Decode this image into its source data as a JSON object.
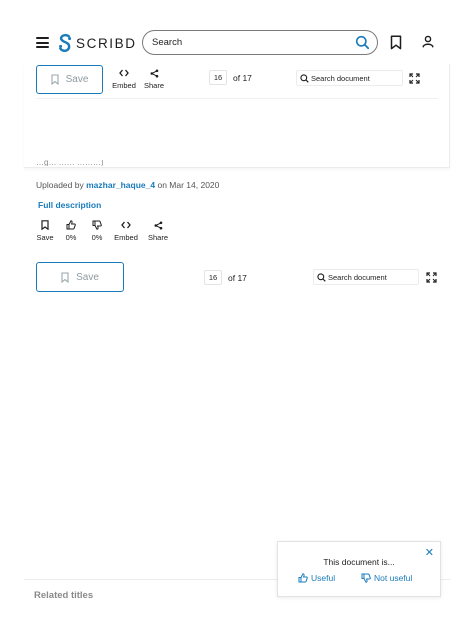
{
  "header": {
    "logo_text": "SCRIBD",
    "search_placeholder": "Search",
    "brand_color": "#1a7bba"
  },
  "toolbar": {
    "save_label": "Save",
    "embed_label": "Embed",
    "share_label": "Share",
    "current_page": "16",
    "page_of": "of 17",
    "search_doc_placeholder": "Search document"
  },
  "document": {
    "uploaded_prefix": "Uploaded by",
    "uploader": "mazhar_haque_4",
    "uploaded_on": "on Mar 14, 2020",
    "full_description_label": "Full description",
    "cut_off_text": "…g… …… ………)"
  },
  "actions": {
    "save_label": "Save",
    "upvote_pct": "0%",
    "downvote_pct": "0%",
    "embed_label": "Embed",
    "share_label": "Share"
  },
  "inline_toolbar": {
    "save_label": "Save",
    "current_page": "16",
    "page_of": "of 17",
    "search_doc_placeholder": "Search document"
  },
  "feedback": {
    "question": "This document is...",
    "useful_label": "Useful",
    "not_useful_label": "Not useful"
  },
  "related": {
    "title": "Related titles"
  },
  "icons": {
    "menu": "hamburger-icon",
    "search": "magnifier-icon",
    "bookmark": "bookmark-icon",
    "user": "user-icon",
    "embed": "code-brackets-icon",
    "share": "share-icon",
    "fullscreen": "expand-icon",
    "thumbs_up": "thumbs-up-icon",
    "thumbs_down": "thumbs-down-icon",
    "close": "close-icon"
  }
}
